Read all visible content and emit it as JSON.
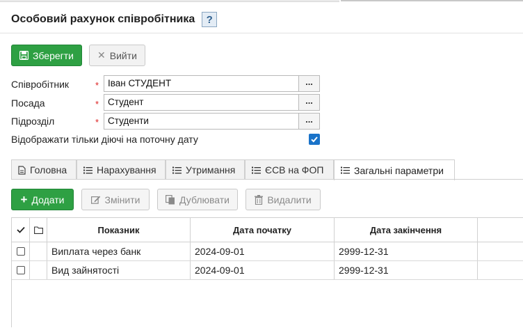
{
  "page": {
    "title": "Особовий рахунок співробітника",
    "help_label": "?"
  },
  "toolbar": {
    "save_label": "Зберегти",
    "exit_label": "Вийти"
  },
  "form": {
    "employee": {
      "label": "Співробітник",
      "value": "Іван СТУДЕНТ"
    },
    "position": {
      "label": "Посада",
      "value": "Студент"
    },
    "department": {
      "label": "Підрозділ",
      "value": "Студенти"
    },
    "lookup_label": "...",
    "required_mark": "*",
    "current_only": {
      "label": "Відображати тільки діючі на поточну дату",
      "checked": true
    }
  },
  "tabs": [
    {
      "label": "Головна",
      "icon": "document-icon",
      "active": false
    },
    {
      "label": "Нарахування",
      "icon": "list-icon",
      "active": false
    },
    {
      "label": "Утримання",
      "icon": "list-icon",
      "active": false
    },
    {
      "label": "ЄСВ на ФОП",
      "icon": "list-icon",
      "active": false
    },
    {
      "label": "Загальні параметри",
      "icon": "list-icon",
      "active": true
    }
  ],
  "actions": {
    "add_label": "Додати",
    "edit_label": "Змінити",
    "duplicate_label": "Дублювати",
    "delete_label": "Видалити"
  },
  "grid": {
    "columns": [
      "Показник",
      "Дата початку",
      "Дата закінчення"
    ],
    "rows": [
      {
        "indicator": "Виплата через банк",
        "start": "2024-09-01",
        "end": "2999-12-31"
      },
      {
        "indicator": "Вид зайнятості",
        "start": "2024-09-01",
        "end": "2999-12-31"
      }
    ]
  },
  "colors": {
    "accent_green": "#2ea043",
    "checkbox_blue": "#1a73c9",
    "required_red": "#dd2222"
  }
}
